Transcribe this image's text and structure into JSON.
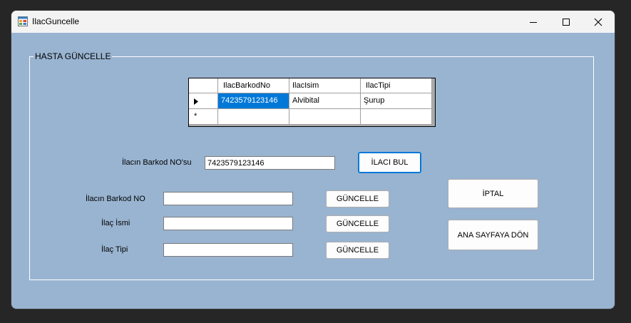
{
  "window": {
    "title": "IlacGuncelle",
    "icon": "winforms-app-icon",
    "controls": [
      "minimize-icon",
      "maximize-icon",
      "close-icon"
    ]
  },
  "group": {
    "label": "HASTA GÜNCELLE"
  },
  "grid": {
    "columns": [
      "IlacBarkodNo",
      "IlacIsim",
      "IlacTipi"
    ],
    "rows": [
      {
        "marker": "current-row-arrow-icon",
        "cells": [
          "7423579123146",
          "Alvibital",
          "Şurup"
        ]
      }
    ],
    "new_row_marker": "new-row-asterisk-icon"
  },
  "search": {
    "label": "İlacın Barkod NO'su",
    "value": "7423579123146",
    "button": "İLACI BUL"
  },
  "edit": {
    "barkod_label": "İlacın Barkod NO",
    "barkod_value": "",
    "barkod_button": "GÜNCELLE",
    "isim_label": "İlaç İsmi",
    "isim_value": "",
    "isim_button": "GÜNCELLE",
    "tipi_label": "İlaç Tipi",
    "tipi_value": "",
    "tipi_button": "GÜNCELLE"
  },
  "actions": {
    "cancel": "İPTAL",
    "home": "ANA SAYFAYA DÖN"
  },
  "colors": {
    "form_background": "#99b4d1",
    "selection": "#0078d7",
    "titlebar": "#f3f3f3"
  }
}
